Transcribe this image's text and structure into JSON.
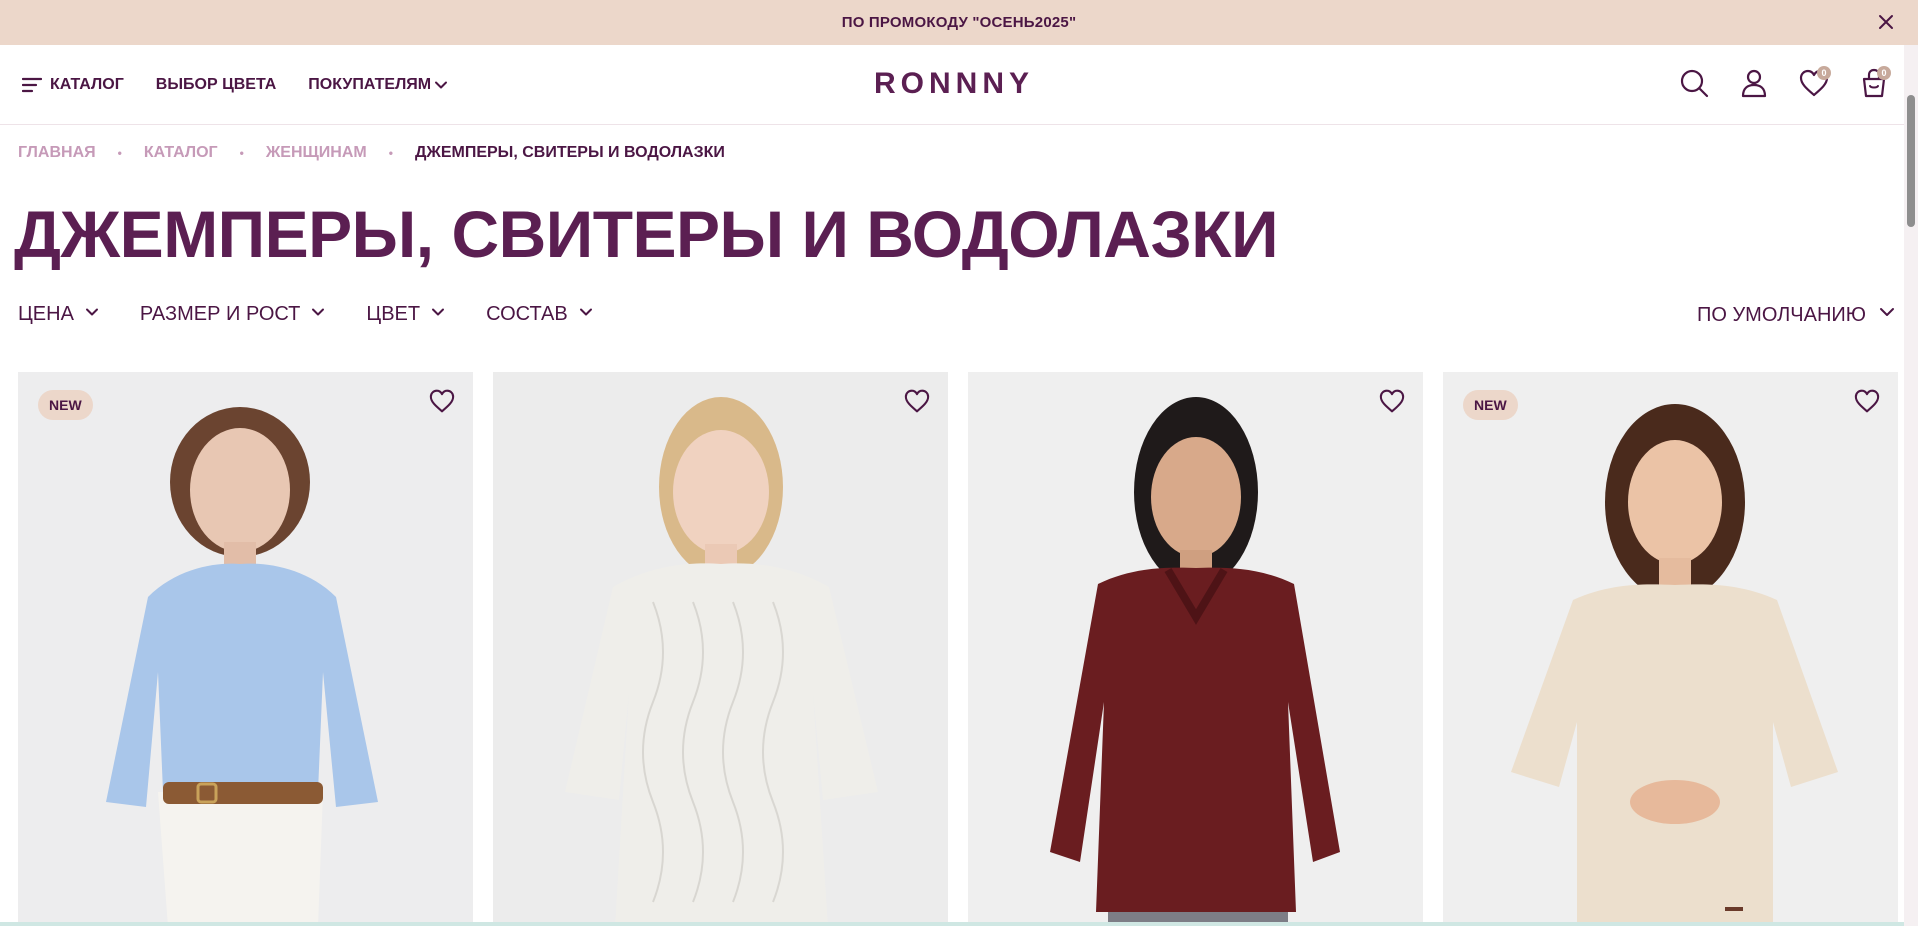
{
  "promo": {
    "text": "ПО ПРОМОКОДУ \"ОСЕНЬ2025\""
  },
  "nav": {
    "catalog": "КАТАЛОГ",
    "color": "ВЫБОР ЦВЕТА",
    "buyers": "ПОКУПАТЕЛЯМ"
  },
  "logo": "RONNNY",
  "header_icons": {
    "wishlist_count": "0",
    "cart_count": "0"
  },
  "breadcrumb": [
    "ГЛАВНАЯ",
    "КАТАЛОГ",
    "ЖЕНЩИНАМ",
    "ДЖЕМПЕРЫ, СВИТЕРЫ И ВОДОЛАЗКИ"
  ],
  "title": "ДЖЕМПЕРЫ, СВИТЕРЫ И ВОДОЛАЗКИ",
  "filters": [
    "ЦЕНА",
    "РАЗМЕР И РОСТ",
    "ЦВЕТ",
    "СОСТАВ"
  ],
  "sort": "ПО УМОЛЧАНИЮ",
  "products": [
    {
      "badge": "NEW",
      "garment_color": "#a9c6ea"
    },
    {
      "badge": "",
      "garment_color": "#efeeea"
    },
    {
      "badge": "",
      "garment_color": "#6a1d20"
    },
    {
      "badge": "NEW",
      "garment_color": "#ecdfcd"
    }
  ],
  "colors": {
    "brand": "#5b1f52",
    "promo_bg": "#ecd7ca",
    "crumb_muted": "#c69ab8"
  }
}
